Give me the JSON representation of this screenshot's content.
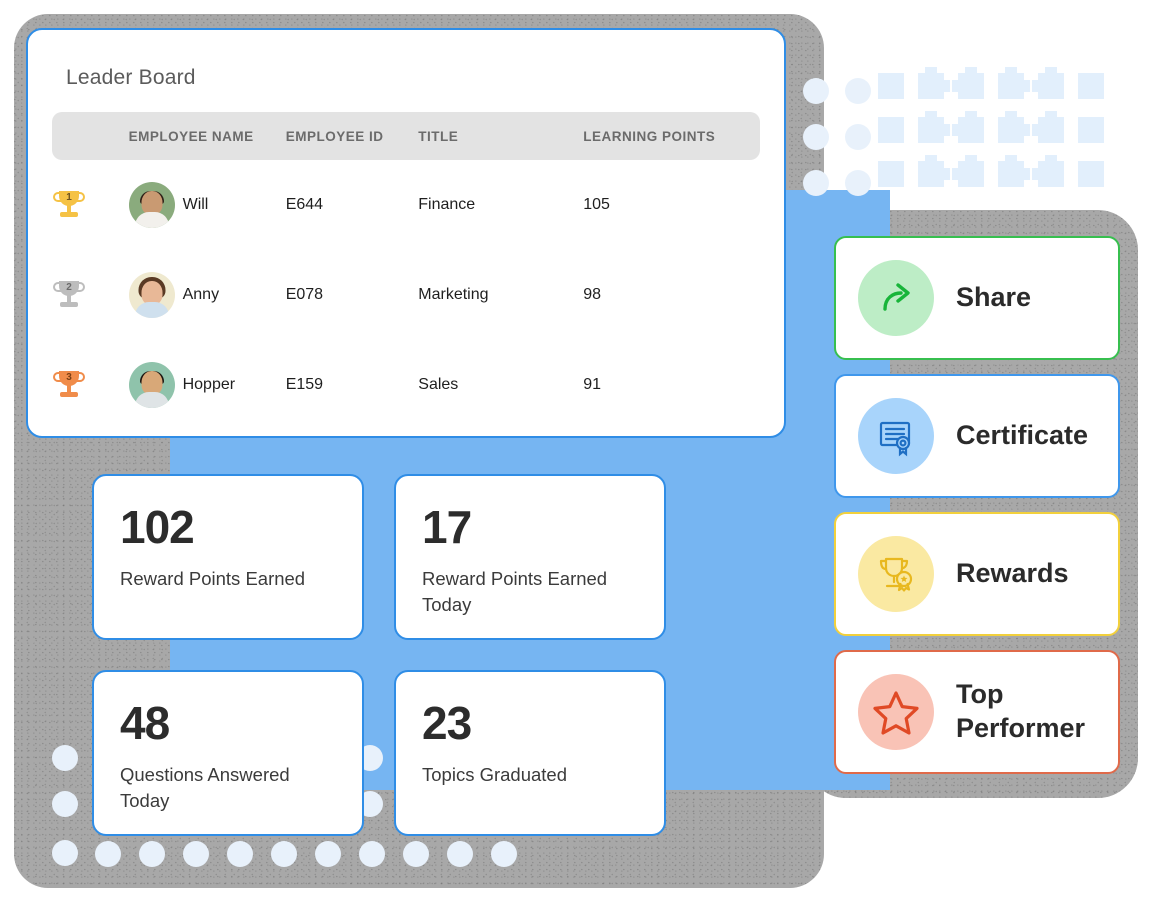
{
  "leaderboard": {
    "title": "Leader Board",
    "columns": [
      "EMPLOYEE NAME",
      "EMPLOYEE ID",
      "TITLE",
      "LEARNING POINTS"
    ],
    "rows": [
      {
        "rank": "1",
        "medal": "gold",
        "name": "Will",
        "id": "E644",
        "title": "Finance",
        "points": "105"
      },
      {
        "rank": "2",
        "medal": "silver",
        "name": "Anny",
        "id": "E078",
        "title": "Marketing",
        "points": "98"
      },
      {
        "rank": "3",
        "medal": "bronze",
        "name": "Hopper",
        "id": "E159",
        "title": "Sales",
        "points": "91"
      }
    ]
  },
  "stats": [
    {
      "value": "102",
      "label": "Reward Points Earned"
    },
    {
      "value": "17",
      "label": "Reward Points Earned Today"
    },
    {
      "value": "48",
      "label": "Questions Answered Today"
    },
    {
      "value": "23",
      "label": "Topics Graduated"
    }
  ],
  "actions": [
    {
      "label": "Share",
      "icon": "share-arrow-icon",
      "accent": "#37bf4f",
      "circle": "#bdedc6"
    },
    {
      "label": "Certificate",
      "icon": "certificate-icon",
      "accent": "#3f97ec",
      "circle": "#a8d4fb"
    },
    {
      "label": "Rewards",
      "icon": "trophy-ribbon-icon",
      "accent": "#f2d03c",
      "circle": "#fae9a2"
    },
    {
      "label": "Top Performer",
      "icon": "star-icon",
      "accent": "#e06a4a",
      "circle": "#f9c3b6"
    }
  ],
  "colors": {
    "panel_blue": "#76b5f2",
    "card_border_blue": "#2f8de6",
    "frame_gray": "#a8a8a8",
    "table_header_gray": "#e3e3e3",
    "dot_light_blue": "#e2effc"
  }
}
